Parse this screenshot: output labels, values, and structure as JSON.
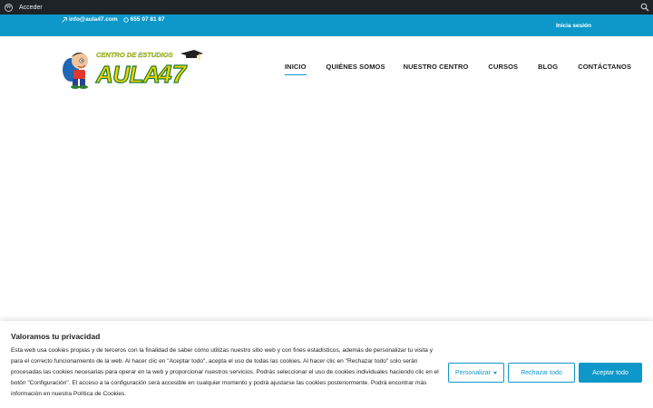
{
  "adminbar": {
    "login_label": "Acceder",
    "wp_icon": "wordpress-icon",
    "search_icon": "search-icon"
  },
  "topbar": {
    "email": "info@aula47.com",
    "phone": "655 07 81 87",
    "login": "Inicia sesión",
    "accent": "#0d98c9"
  },
  "logo": {
    "tagline": "CENTRO DE ESTUDIOS",
    "name": "AULA",
    "number": "47"
  },
  "nav": [
    {
      "label": "INICIO"
    },
    {
      "label": "QUIÉNES SOMOS"
    },
    {
      "label": "NUESTRO CENTRO"
    },
    {
      "label": "CURSOS"
    },
    {
      "label": "BLOG"
    },
    {
      "label": "CONTÁCTANOS"
    }
  ],
  "cookie": {
    "title": "Valoramos tu privacidad",
    "text": "Esta web usa cookies propias y de terceros con la finalidad de saber cómo utilizas nuestro sitio web y con fines estadísticos, además de personalizar tu visita y para el correcto funcionamiento de la web. Al hacer clic en \"Aceptar todo\", acepta el uso de todas las cookies. Al hacer clic en \"Rechazar todo\" solo serán procesadas las cookies necesarias para operar en la web y proporcionar nuestros servicios. Podrás seleccionar el uso de cookies individuales haciendo clic en el botón \"Configuración\". El acceso a la configuración será accesible en cualquier momento y podrá ajustarse las cookies posteriormente. Podrá encontrar más información en nuestra Política de Cookies.",
    "customize": "Personalizar",
    "reject": "Rechazar todo",
    "accept": "Aceptar todo"
  }
}
